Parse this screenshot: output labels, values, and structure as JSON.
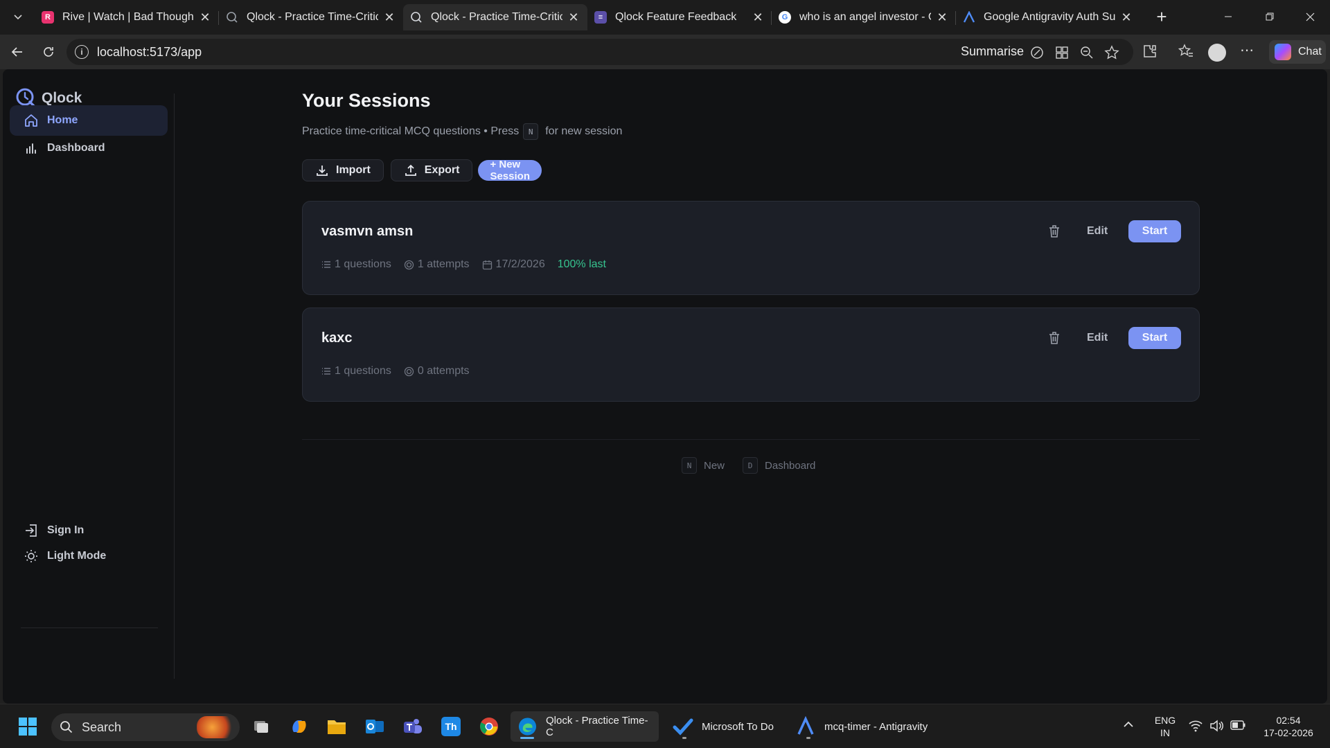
{
  "browser": {
    "tabs": [
      {
        "title": "Rive | Watch | Bad Thoughts |",
        "favicon": "rive-icon",
        "active": false
      },
      {
        "title": "Qlock - Practice Time-Critical",
        "favicon": "qlock-icon",
        "active": false
      },
      {
        "title": "Qlock - Practice Time-Critical",
        "favicon": "qlock-icon",
        "active": true
      },
      {
        "title": "Qlock Feature Feedback",
        "favicon": "form-icon",
        "active": false
      },
      {
        "title": "who is an angel investor - Goo",
        "favicon": "google-icon",
        "active": false
      },
      {
        "title": "Google Antigravity Auth Succ",
        "favicon": "antigravity-icon",
        "active": false
      }
    ],
    "url": "localhost:5173/app",
    "summarise_label": "Summarise",
    "chat_label": "Chat"
  },
  "app": {
    "brand": "Qlock",
    "nav": [
      {
        "label": "Home",
        "icon": "home-icon",
        "active": true
      },
      {
        "label": "Dashboard",
        "icon": "bar-chart-icon",
        "active": false
      }
    ],
    "bottom_nav": [
      {
        "label": "Sign In",
        "icon": "sign-in-icon"
      },
      {
        "label": "Light Mode",
        "icon": "sun-icon"
      }
    ],
    "page_title": "Your Sessions",
    "subtitle_before": "Practice time-critical MCQ questions • Press",
    "subtitle_key": "N",
    "subtitle_after": "for new session",
    "actions": {
      "import_label": "Import",
      "export_label": "Export",
      "new_session_label": "+ New Session"
    },
    "sessions": [
      {
        "name": "vasmvn amsn",
        "questions": "1 questions",
        "attempts": "1 attempts",
        "date": "17/2/2026",
        "score": "100% last",
        "edit_label": "Edit",
        "start_label": "Start"
      },
      {
        "name": "kaxc",
        "questions": "1 questions",
        "attempts": "0 attempts",
        "edit_label": "Edit",
        "start_label": "Start"
      }
    ],
    "shortcuts": [
      {
        "key": "N",
        "label": "New"
      },
      {
        "key": "D",
        "label": "Dashboard"
      }
    ]
  },
  "taskbar": {
    "search_label": "Search",
    "windows": [
      {
        "label": "Qlock - Practice Time-C",
        "active": true
      },
      {
        "label": "Microsoft To Do",
        "active": false
      },
      {
        "label": "mcq-timer - Antigravity",
        "active": false
      }
    ],
    "language_line1": "ENG",
    "language_line2": "IN",
    "time": "02:54",
    "date": "17-02-2026"
  },
  "colors": {
    "accent": "#7b93f2",
    "success": "#36c48f",
    "background": "#111214",
    "card": "#1c1f27"
  }
}
